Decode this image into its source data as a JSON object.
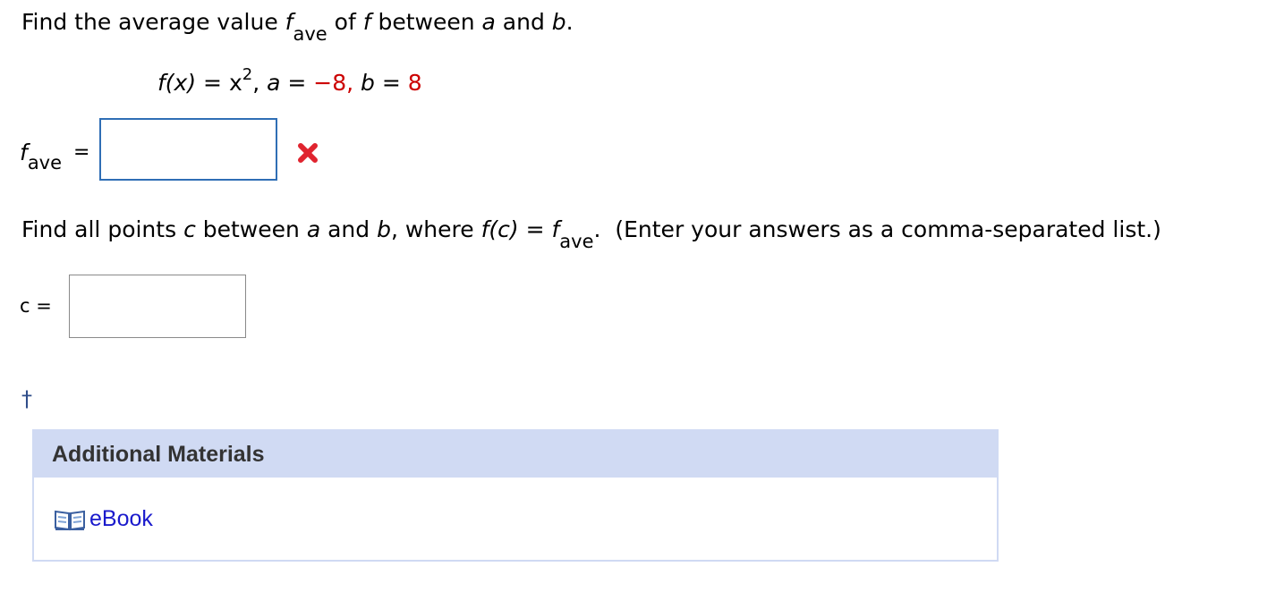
{
  "question1": {
    "prompt_pre": "Find the average value ",
    "prompt_f": "f",
    "prompt_sub": "ave",
    "prompt_mid": " of ",
    "prompt_f2": "f",
    "prompt_between": " between ",
    "prompt_a": "a",
    "prompt_and": " and ",
    "prompt_b": "b",
    "prompt_end": "."
  },
  "equation": {
    "fx": "f(x)",
    "equals": " = ",
    "x": "x",
    "exp": "2",
    "comma": ",",
    "a": "a",
    "a_eq": " = ",
    "a_val": "−8,",
    "b": "b",
    "b_eq": " = ",
    "b_val": "8"
  },
  "fave_answer": {
    "label_f": "f",
    "label_sub": "ave",
    "equals": "=",
    "value": "",
    "status_icon": "red-x-incorrect-icon",
    "status_color": "#e0242f"
  },
  "question2": {
    "pre": "Find all points ",
    "c": "c",
    "between": " between ",
    "a": "a",
    "and": " and ",
    "b": "b",
    "where": ", where ",
    "fc": "f(c)",
    "eq": " = ",
    "f": "f",
    "sub": "ave",
    "dot": ".",
    "instruction": "  (Enter your answers as a comma-separated list.)"
  },
  "c_answer": {
    "label": "c =",
    "value": ""
  },
  "footnote": {
    "dagger": "†"
  },
  "additional_materials": {
    "title": "Additional Materials",
    "link_icon": "book-icon",
    "link_label": "eBook"
  },
  "colors": {
    "accent_red": "#cc0000",
    "panel_bg": "#d0daf3",
    "link_blue": "#1a1acc",
    "input_focus_border": "#2f6eb5"
  }
}
